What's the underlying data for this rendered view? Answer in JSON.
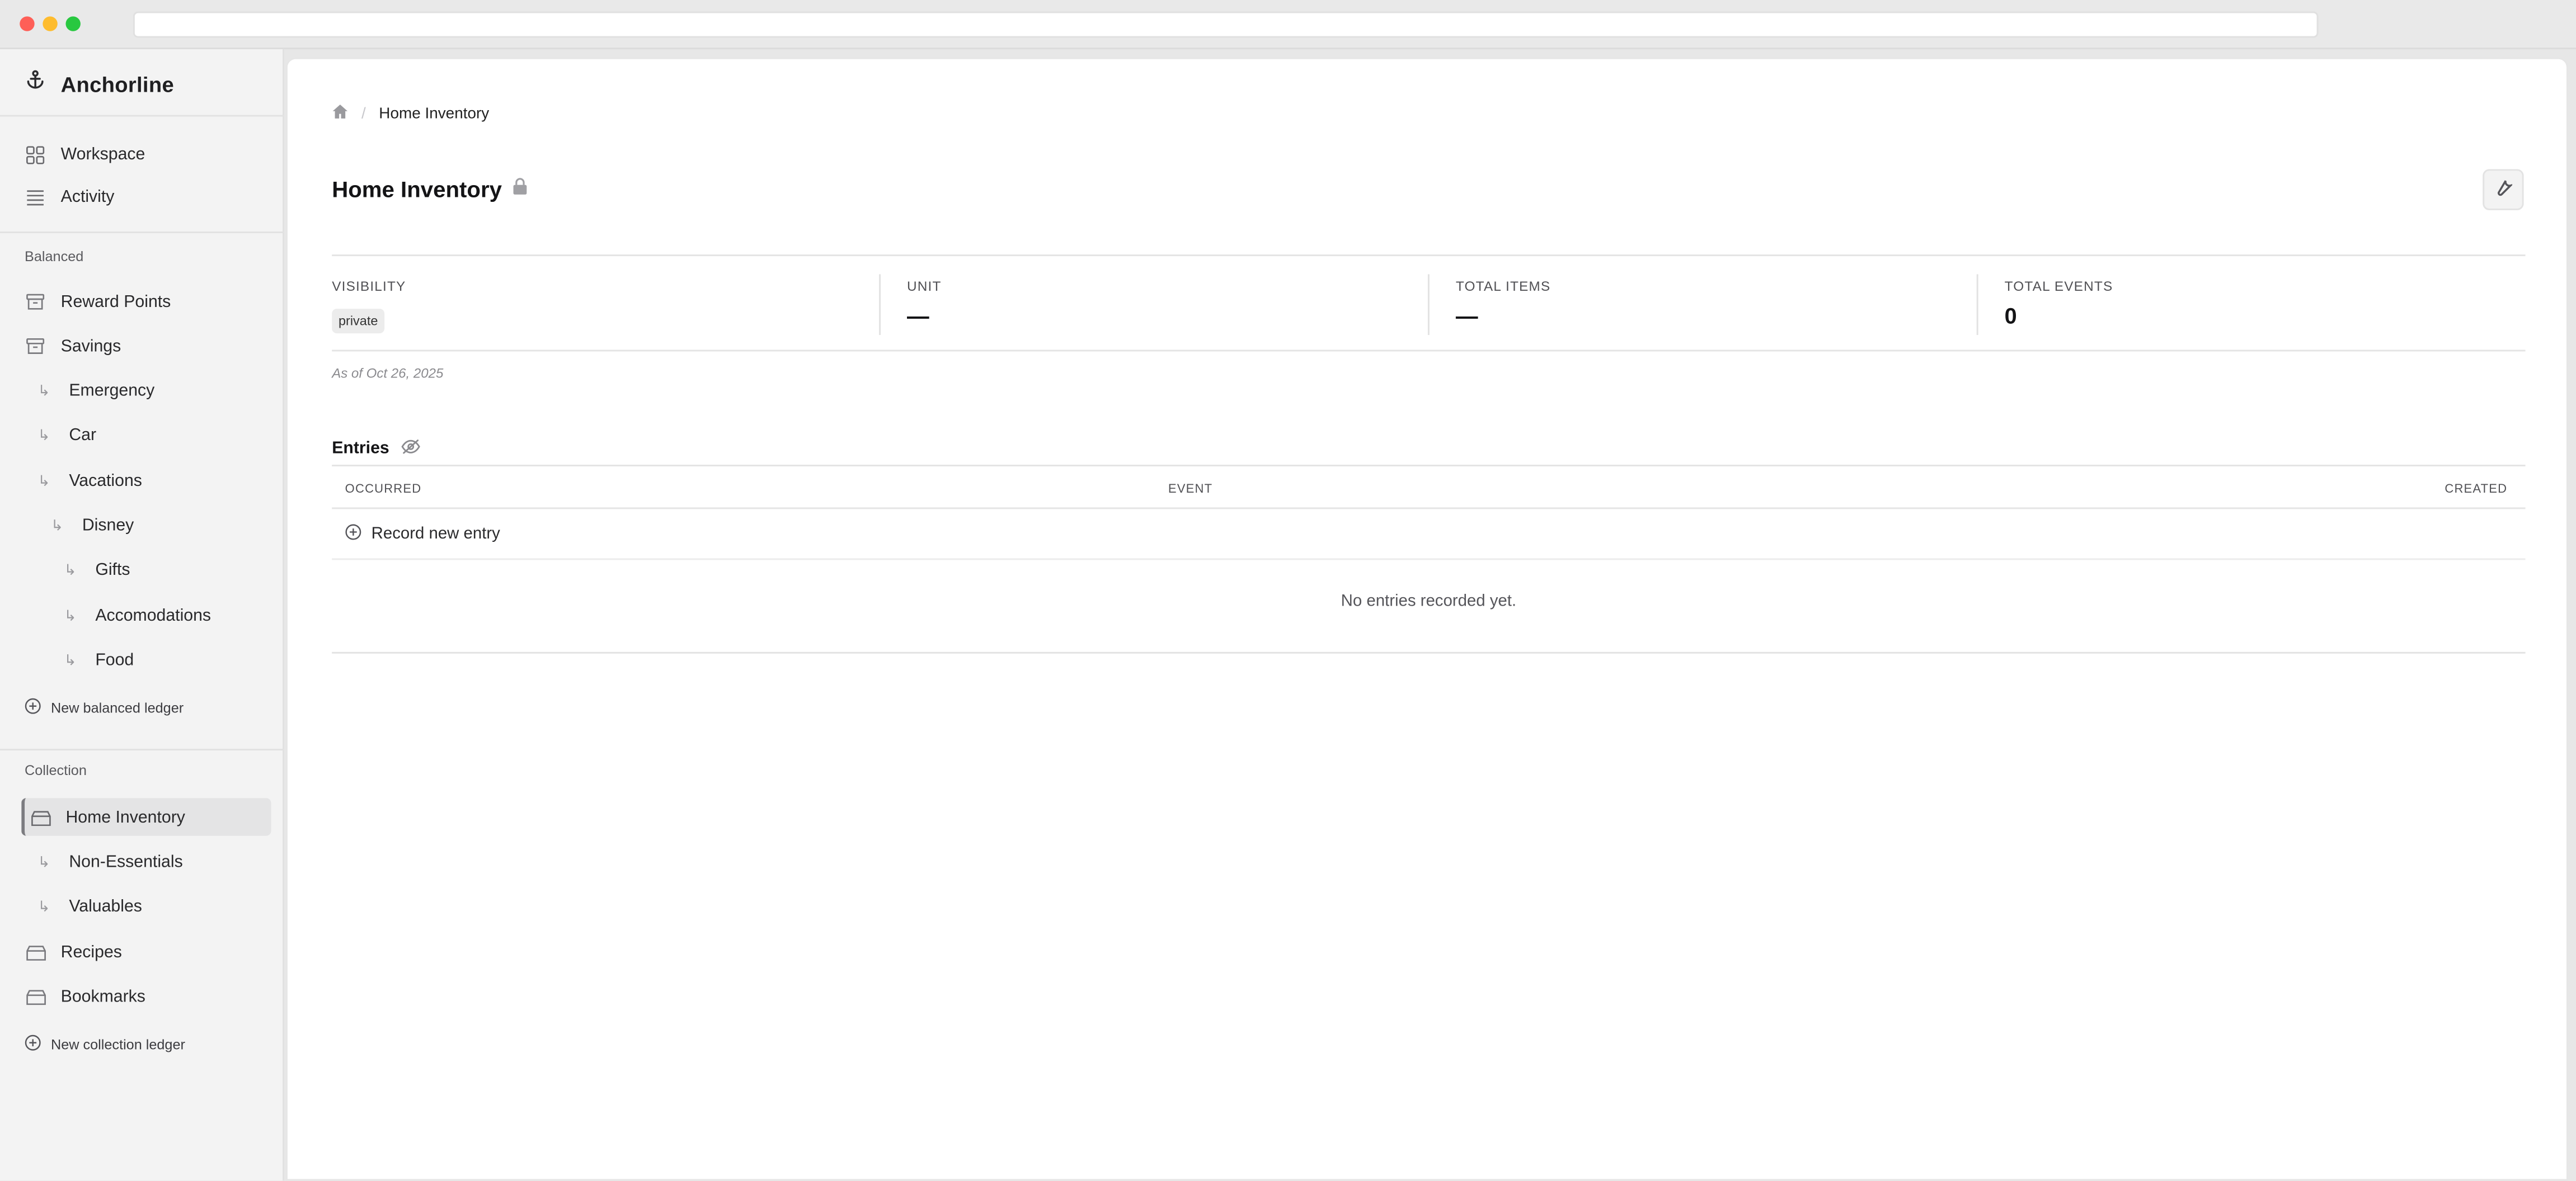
{
  "app": {
    "name": "Anchorline"
  },
  "sidebar": {
    "top_items": [
      {
        "label": "Workspace",
        "icon": "grid-icon"
      },
      {
        "label": "Activity",
        "icon": "list-icon"
      }
    ],
    "sections": [
      {
        "label": "Balanced",
        "ledgers": [
          {
            "label": "Reward Points",
            "level": 0
          },
          {
            "label": "Savings",
            "level": 0
          },
          {
            "label": "Emergency",
            "level": 1
          },
          {
            "label": "Car",
            "level": 1
          },
          {
            "label": "Vacations",
            "level": 1
          },
          {
            "label": "Disney",
            "level": 2
          },
          {
            "label": "Gifts",
            "level": 3
          },
          {
            "label": "Accomodations",
            "level": 3
          },
          {
            "label": "Food",
            "level": 3
          }
        ],
        "new_label": "New balanced ledger"
      },
      {
        "label": "Collection",
        "ledgers": [
          {
            "label": "Home Inventory",
            "level": 0,
            "active": true
          },
          {
            "label": "Non-Essentials",
            "level": 1
          },
          {
            "label": "Valuables",
            "level": 1
          },
          {
            "label": "Recipes",
            "level": 0
          },
          {
            "label": "Bookmarks",
            "level": 0
          }
        ],
        "new_label": "New collection ledger"
      }
    ]
  },
  "breadcrumb": {
    "current": "Home Inventory"
  },
  "page": {
    "title": "Home Inventory",
    "locked": true
  },
  "stats": {
    "visibility": {
      "label": "VISIBILITY",
      "value": "private"
    },
    "unit": {
      "label": "UNIT",
      "value": "—"
    },
    "total_items": {
      "label": "TOTAL ITEMS",
      "value": "—"
    },
    "total_events": {
      "label": "TOTAL EVENTS",
      "value": "0"
    }
  },
  "as_of": "As of Oct 26, 2025",
  "entries": {
    "title": "Entries",
    "columns": {
      "occurred": "OCCURRED",
      "event": "EVENT",
      "created": "CREATED"
    },
    "record_label": "Record new entry",
    "empty_text": "No entries recorded yet."
  },
  "colors": {
    "active_bg": "#e4e4e5",
    "sidebar_bg": "#f3f3f3",
    "main_bg": "#ffffff"
  }
}
